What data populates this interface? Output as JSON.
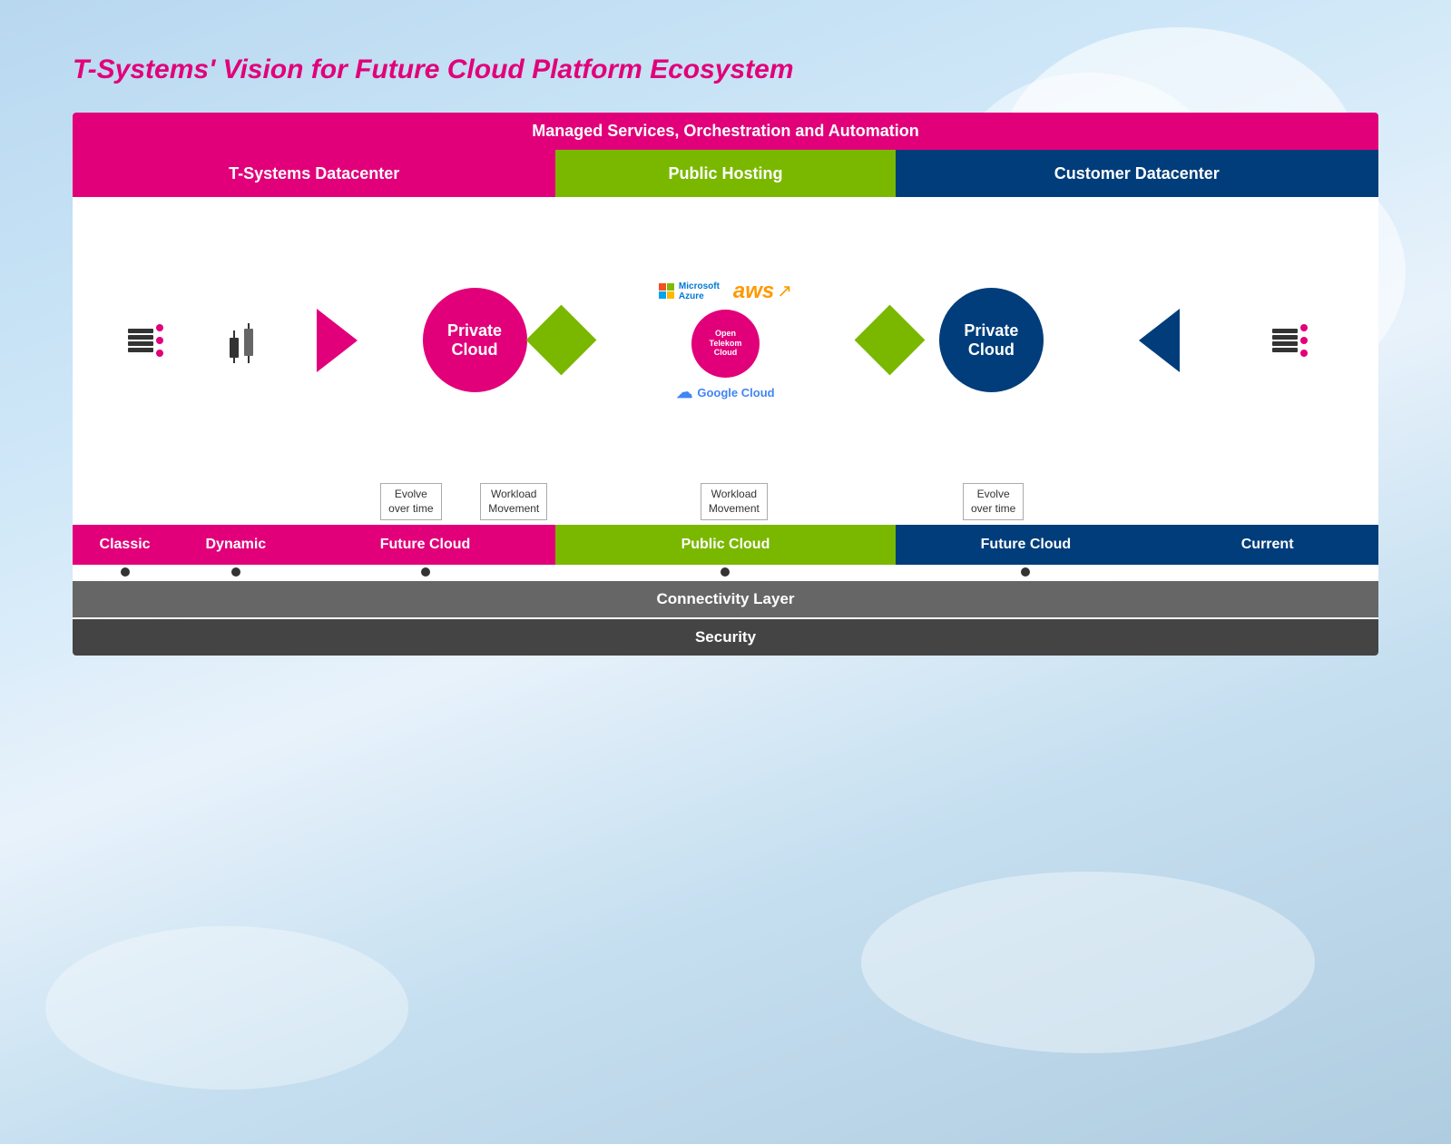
{
  "title": "T-Systems' Vision for Future Cloud Platform Ecosystem",
  "diagram": {
    "managed_bar": "Managed Services, Orchestration and Automation",
    "section_tsdc": "T-Systems Datacenter",
    "section_public": "Public Hosting",
    "section_customer": "Customer Datacenter",
    "private_cloud_left": "Private\nCloud",
    "private_cloud_right": "Private\nCloud",
    "azure_label": "Microsoft\nAzure",
    "aws_label": "aws",
    "open_telekom_label": "Open\nTelekom\nCloud",
    "google_cloud_label": "Google Cloud",
    "evolve_left": "Evolve\nover time",
    "workload_left": "Workload\nMovement",
    "workload_right": "Workload\nMovement",
    "evolve_right": "Evolve\nover time",
    "cat_classic": "Classic",
    "cat_dynamic": "Dynamic",
    "cat_future_cloud_l": "Future Cloud",
    "cat_public_cloud": "Public Cloud",
    "cat_future_cloud_r": "Future Cloud",
    "cat_current": "Current",
    "connectivity_label": "Connectivity Layer",
    "security_label": "Security"
  },
  "colors": {
    "magenta": "#e2007a",
    "green": "#7ab800",
    "dark_blue": "#003d7a",
    "aws_orange": "#ff9900",
    "azure_blue": "#0078d4",
    "google_blue": "#4285f4"
  }
}
